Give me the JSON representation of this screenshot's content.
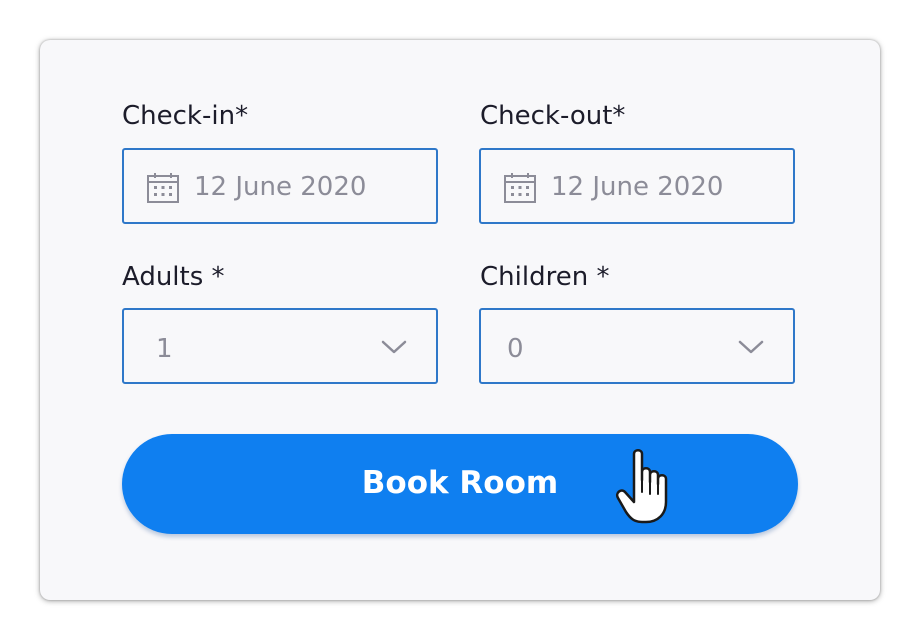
{
  "form": {
    "checkin": {
      "label": "Check-in*",
      "value": "12 June 2020",
      "icon": "calendar-icon"
    },
    "checkout": {
      "label": "Check-out*",
      "value": "12 June 2020",
      "icon": "calendar-icon"
    },
    "adults": {
      "label": "Adults *",
      "value": "1",
      "icon": "chevron-down-icon"
    },
    "children": {
      "label": "Children *",
      "value": "0",
      "icon": "chevron-down-icon"
    },
    "submit": {
      "label": "Book Room",
      "icon": "hand-pointer-icon"
    }
  },
  "colors": {
    "accent": "#0f7ff0",
    "field_border": "#2f78c9",
    "label_text": "#1c1c2a",
    "value_text": "#8c8c98",
    "card_bg": "#f8f8fa"
  }
}
